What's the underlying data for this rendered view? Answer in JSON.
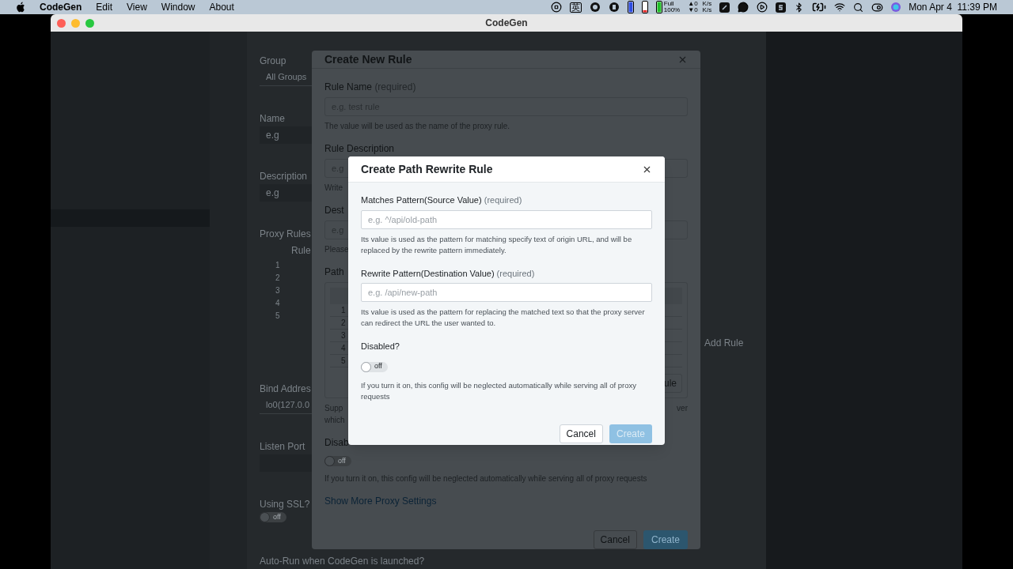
{
  "menu_bar": {
    "app_name": "CodeGen",
    "menus": [
      "Edit",
      "View",
      "Window",
      "About"
    ],
    "input_method": "英",
    "battery_label": "Full",
    "battery_percent": "100%",
    "net_up": "▲0",
    "net_down": "▼0",
    "net_unit_up": "K/s",
    "net_unit_down": "K/s",
    "clock": "Mon Apr 4  11:39 PM"
  },
  "window": {
    "title": "CodeGen"
  },
  "drawer": {
    "fields": [
      {
        "kind": "label",
        "text": "Group"
      },
      {
        "kind": "select",
        "text": "All Groups"
      },
      {
        "kind": "label",
        "text": "Name"
      },
      {
        "kind": "input",
        "text": "e.g"
      },
      {
        "kind": "label",
        "text": "Description"
      },
      {
        "kind": "input",
        "text": "e.g"
      },
      {
        "kind": "label",
        "text": "Proxy Rules"
      },
      {
        "kind": "rules",
        "header": "Rule",
        "rows": [
          "1",
          "2",
          "3",
          "4",
          "5"
        ]
      },
      {
        "kind": "label",
        "text": "Bind Addres"
      },
      {
        "kind": "select",
        "text": "lo0(127.0.0"
      },
      {
        "kind": "label",
        "text": "Listen Port"
      },
      {
        "kind": "input"
      },
      {
        "kind": "label",
        "text": "Using SSL?"
      },
      {
        "kind": "toggle",
        "text": "off",
        "on": false
      },
      {
        "kind": "label",
        "text": "Auto-Run when CodeGen is launched?"
      }
    ],
    "add_rule_button": "Add Rule"
  },
  "rule_dialog": {
    "title": "Create New Rule",
    "rule_name_label": "Rule Name",
    "rule_name_required": "(required)",
    "rule_name_placeholder": "e.g. test rule",
    "rule_name_hint": "The value will be used as the name of the proxy rule.",
    "description_label": "Rule Description",
    "description_placeholder": "e.g",
    "description_hint": "Write",
    "dest_label": "Dest",
    "dest_placeholder": "e.g",
    "dest_hint": "Please",
    "path_label": "Path",
    "path_rows": [
      "1",
      "2",
      "3",
      "4",
      "5"
    ],
    "path_button": "ule",
    "support_hint_left": [
      "Supp",
      "which"
    ],
    "support_hint_right": "ver",
    "disabled_label": "Disab",
    "disabled_toggle": {
      "text": "off",
      "on": false
    },
    "disabled_hint": "If you turn it on, this config will be neglected automatically while serving all of proxy requests",
    "more_link": "Show More Proxy Settings",
    "cancel_button": "Cancel",
    "create_button": "Create"
  },
  "rewrite_dialog": {
    "title": "Create Path Rewrite Rule",
    "fields": [
      {
        "label": "Matches Pattern(Source Value)",
        "required": "(required)",
        "placeholder": "e.g. ^/api/old-path",
        "hint": "Its value is used as the pattern for matching specify text of origin URL, and will be replaced by the rewrite pattern immediately."
      },
      {
        "label": "Rewrite Pattern(Destination Value)",
        "required": "(required)",
        "placeholder": "e.g. /api/new-path",
        "hint": "Its value is used as the pattern for replacing the matched text so that the proxy server can redirect the URL the user wanted to."
      }
    ],
    "disabled_label": "Disabled?",
    "disabled_toggle": {
      "text": "off",
      "on": false
    },
    "disabled_hint": "If you turn it on, this config will be neglected automatically while serving all of proxy requests",
    "cancel_button": "Cancel",
    "create_button": "Create",
    "create_disabled": true
  }
}
